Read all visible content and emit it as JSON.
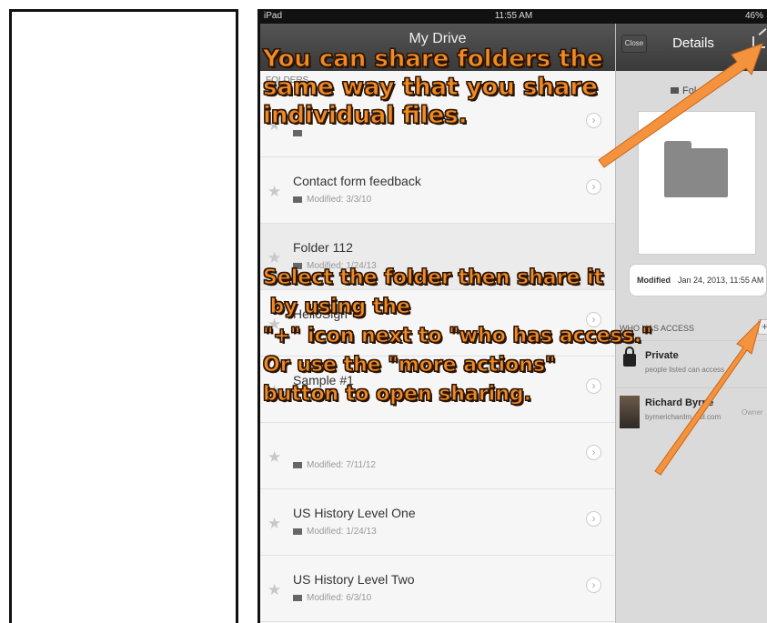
{
  "status_bar": {
    "device": "iPad",
    "time": "11:55 AM",
    "battery": "46%"
  },
  "drive_nav": {
    "title": "My Drive",
    "section_header": "FOLDERS"
  },
  "folders": [
    {
      "name": "",
      "modified": ""
    },
    {
      "name": "Contact form feedback",
      "modified": "Modified: 3/3/10"
    },
    {
      "name": "Folder 112",
      "modified": "Modified: 1/24/13"
    },
    {
      "name": "HelloSign",
      "modified": ""
    },
    {
      "name": "Sample #1",
      "modified": ""
    },
    {
      "name": "",
      "modified": "Modified: 7/11/12"
    },
    {
      "name": "US History Level One",
      "modified": "Modified: 1/24/13"
    },
    {
      "name": "US History Level Two",
      "modified": "Modified: 6/3/10"
    }
  ],
  "details": {
    "close_label": "Close",
    "title": "Details",
    "folder_label": "Fol",
    "modified_key": "Modified",
    "modified_value": "Jan 24, 2013, 11:55 AM",
    "who_has_access": "WHO HAS ACCESS",
    "plus_label": "+",
    "private_title": "Private",
    "private_sub": "people listed can access",
    "owner_name": "Richard Byrne",
    "owner_email": "byrnerichardm...ail.com",
    "owner_role": "Owner"
  },
  "annotations": {
    "callout_1": [
      "You can share folders the",
      "same way that you share",
      "individual files."
    ],
    "callout_2": [
      "Select the folder then share it",
      " by using the",
      "\"+\" icon next to \"who has access.\"",
      "Or use the \"more actions\"",
      "button to open sharing."
    ]
  },
  "colors": {
    "callout_fill": "#f08a24",
    "arrow": "#f5923e",
    "nav_bar": "#454545"
  },
  "icons": [
    "star-icon",
    "folder-icon",
    "chevron-right-icon",
    "share-icon",
    "plus-icon",
    "lock-icon"
  ]
}
